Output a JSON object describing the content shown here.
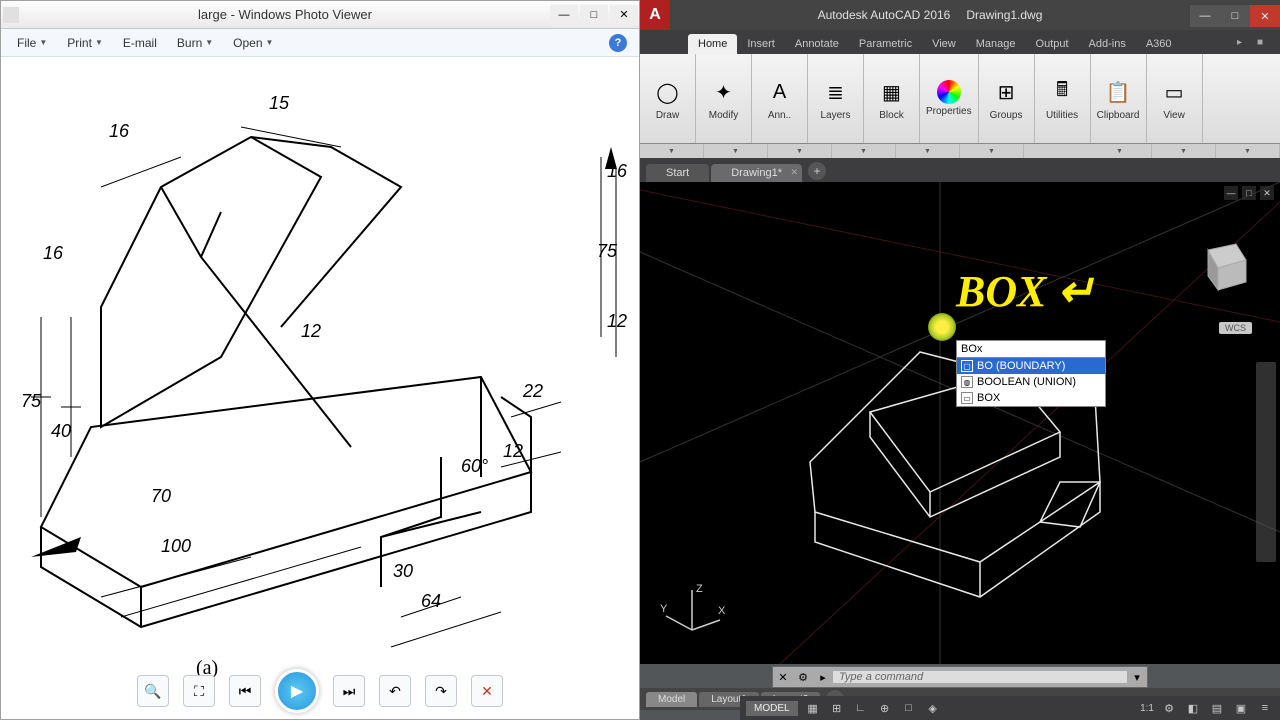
{
  "photoviewer": {
    "title": "large - Windows Photo Viewer",
    "menus": {
      "file": "File",
      "print": "Print",
      "email": "E-mail",
      "burn": "Burn",
      "open": "Open"
    },
    "dims": {
      "d15": "15",
      "d16a": "16",
      "d16b": "16",
      "d12a": "12",
      "d75": "75",
      "d40": "40",
      "d70": "70",
      "d100": "100",
      "d30": "30",
      "d64": "64",
      "d22": "22",
      "d12b": "12",
      "d60": "60°",
      "d16c": "16",
      "d75b": "75",
      "d12c": "12"
    },
    "subfig": "(a)"
  },
  "autocad": {
    "title_app": "Autodesk AutoCAD 2016",
    "title_doc": "Drawing1.dwg",
    "ribbon_tabs": {
      "home": "Home",
      "insert": "Insert",
      "annotate": "Annotate",
      "parametric": "Parametric",
      "view": "View",
      "manage": "Manage",
      "output": "Output",
      "addins": "Add-ins",
      "a360": "A360"
    },
    "panels": {
      "draw": "Draw",
      "modify": "Modify",
      "ann": "Ann..",
      "layers": "Layers",
      "block": "Block",
      "properties": "Properties",
      "groups": "Groups",
      "utilities": "Utilities",
      "clipboard": "Clipboard",
      "view": "View"
    },
    "file_tabs": {
      "start": "Start",
      "drawing": "Drawing1*"
    },
    "overlay_text": "BOX ↵",
    "cmd_input": "BOx",
    "autocomplete": {
      "opt1": "BO (BOUNDARY)",
      "opt2": "BOOLEAN (UNION)",
      "opt3": "BOX"
    },
    "wcs": "WCS",
    "ucs": {
      "x": "X",
      "y": "Y",
      "z": "Z"
    },
    "cmdline_placeholder": "Type a command",
    "layout_tabs": {
      "model": "Model",
      "l1": "Layout1",
      "l2": "Layout2"
    },
    "status": {
      "model": "MODEL",
      "scale": "1:1"
    }
  }
}
